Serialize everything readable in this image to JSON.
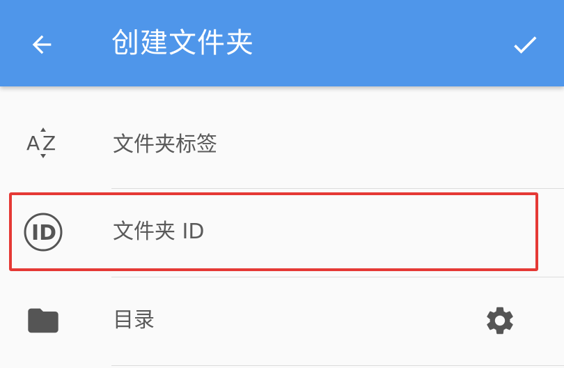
{
  "appbar": {
    "title": "创建文件夹",
    "back_icon": "arrow-left-icon",
    "confirm_icon": "check-icon",
    "color": "#4f96ea"
  },
  "rows": [
    {
      "label": "文件夹标签",
      "icon": "sort-az-icon"
    },
    {
      "label": "文件夹 ID",
      "icon": "id-icon"
    },
    {
      "label": "目录",
      "icon": "folder-icon",
      "action_icon": "gear-icon"
    }
  ],
  "highlight_color": "#e53935"
}
